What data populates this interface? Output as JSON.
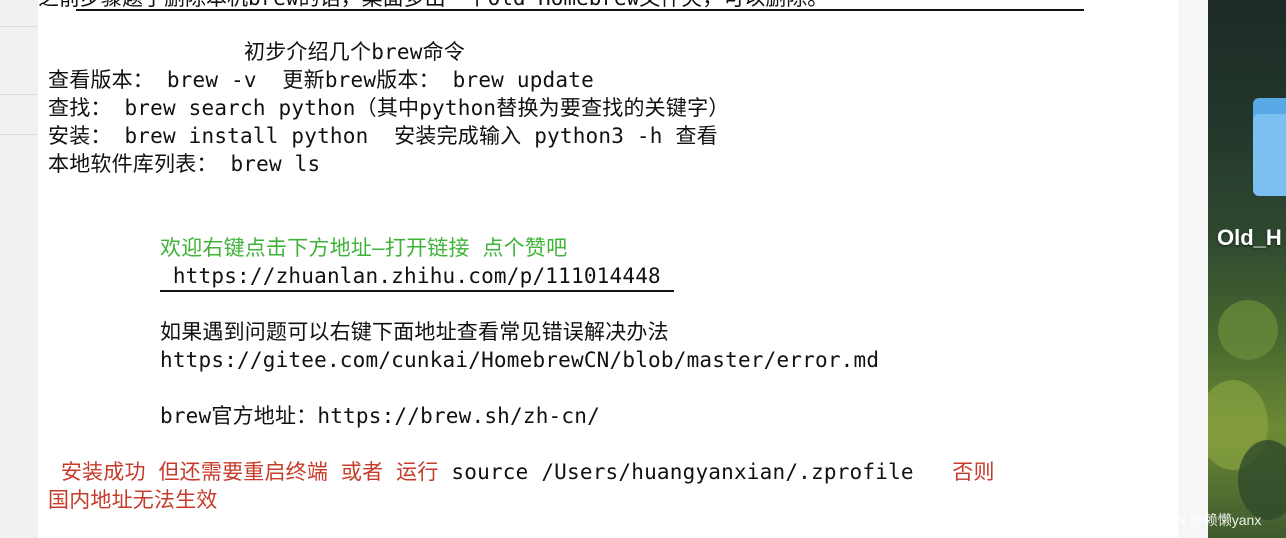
{
  "terminal": {
    "cut_top_line": "之前步骤题了删除本机brew的话，桌面多出一个Old_Homebrew文件夹，可以删除。",
    "heading": "初步介绍几个brew命令",
    "cmd_version": "查看版本： brew -v  更新brew版本： brew update",
    "cmd_search": "查找： brew search python（其中python替换为要查找的关键字）",
    "cmd_install": "安装： brew install python  安装完成输入 python3 -h 查看",
    "cmd_list": "本地软件库列表： brew ls",
    "welcome": "欢迎右键点击下方地址—打开链接 点个赞吧",
    "zhihu_link": " https://zhuanlan.zhihu.com/p/111014448 ",
    "problem_note": "如果遇到问题可以右键下面地址查看常见错误解决办法",
    "gitee_link": "https://gitee.com/cunkai/HomebrewCN/blob/master/error.md",
    "official_prefix": "brew官方地址：",
    "official_link": "https://brew.sh/zh-cn/",
    "success_part1": " 安装成功 但还需要重启终端 或者 运行",
    "success_cmd": " source /Users/huangyanxian/.zprofile  ",
    "success_part2": " 否则",
    "success_line2": "国内地址无法生效"
  },
  "desktop": {
    "folder_label": "Old_H",
    "folder_icon": "folder-icon"
  },
  "watermark": "CSDN @赖懒yanx",
  "colors": {
    "green_text": "#3fb338",
    "red_text": "#c63b2a",
    "folder": "#7cc0f2"
  }
}
